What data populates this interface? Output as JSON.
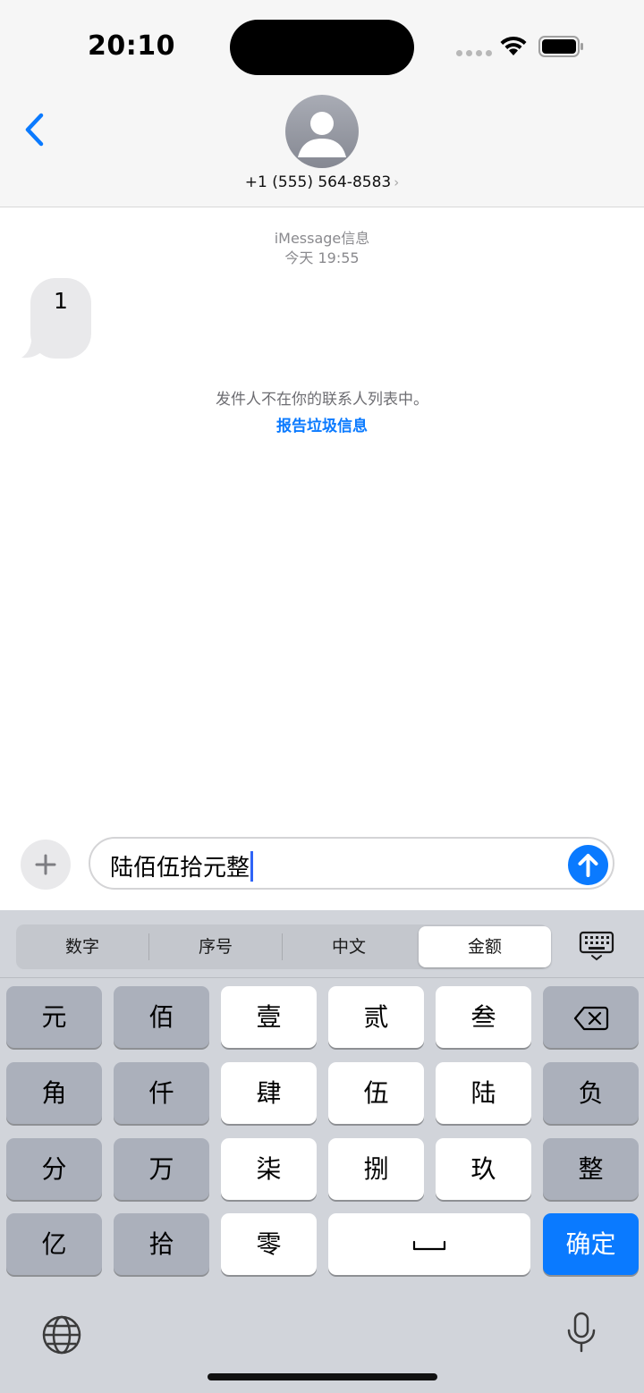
{
  "status": {
    "time": "20:10"
  },
  "contact": {
    "phone": "+1 (555) 564-8583",
    "chevron": "›"
  },
  "thread": {
    "service": "iMessage信息",
    "timestamp": "今天 19:55",
    "messages": [
      {
        "text": "1",
        "direction": "incoming"
      }
    ],
    "notice": "发件人不在你的联系人列表中。",
    "report_link": "报告垃圾信息"
  },
  "composer": {
    "value": "陆佰伍拾元整"
  },
  "keyboard": {
    "modes": [
      "数字",
      "序号",
      "中文",
      "金额"
    ],
    "selected_mode": "金额",
    "rows": [
      [
        "元",
        "佰",
        "壹",
        "贰",
        "叁",
        "delete"
      ],
      [
        "角",
        "仟",
        "肆",
        "伍",
        "陆",
        "负"
      ],
      [
        "分",
        "万",
        "柒",
        "捌",
        "玖",
        "整"
      ],
      [
        "亿",
        "拾",
        "零",
        "space",
        "确定"
      ]
    ],
    "keys": {
      "r0": [
        "元",
        "佰",
        "壹",
        "贰",
        "叁"
      ],
      "r1": [
        "角",
        "仟",
        "肆",
        "伍",
        "陆",
        "负"
      ],
      "r2": [
        "分",
        "万",
        "柒",
        "捌",
        "玖",
        "整"
      ],
      "r3": [
        "亿",
        "拾",
        "零"
      ],
      "confirm": "确定"
    }
  },
  "colors": {
    "accent": "#0a7aff",
    "bubble": "#e9e9eb",
    "keyboard_bg": "#d1d4da"
  }
}
